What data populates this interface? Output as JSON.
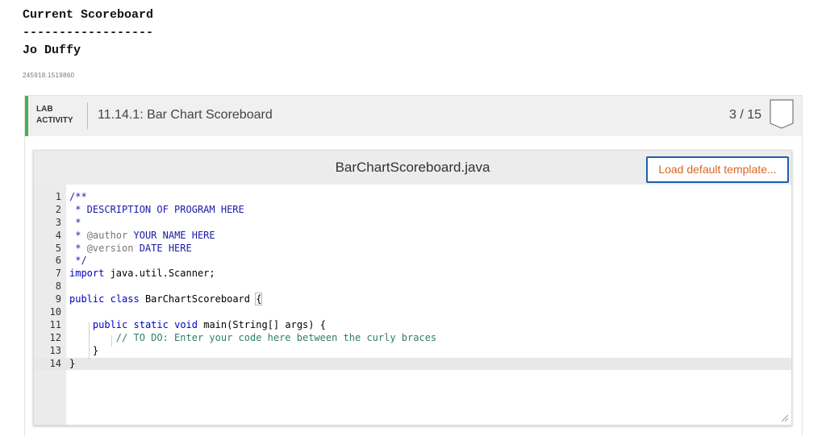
{
  "header": {
    "line1": "Current Scoreboard",
    "line2": "------------------",
    "line3": "Jo Duffy",
    "id_text": "245918.1519860"
  },
  "lab": {
    "type_line1": "LAB",
    "type_line2": "ACTIVITY",
    "title": "11.14.1: Bar Chart Scoreboard",
    "score": "3 / 15",
    "accent": "#4caf50"
  },
  "editor": {
    "filename": "BarChartScoreboard.java",
    "load_button": "Load default template...",
    "active_line": 14,
    "lines": [
      {
        "n": "1",
        "text": "/**"
      },
      {
        "n": "2",
        "text": " * DESCRIPTION OF PROGRAM HERE"
      },
      {
        "n": "3",
        "text": " *"
      },
      {
        "n": "4",
        "text": " * @author YOUR NAME HERE"
      },
      {
        "n": "5",
        "text": " * @version DATE HERE"
      },
      {
        "n": "6",
        "text": " */"
      },
      {
        "n": "7",
        "text": "import java.util.Scanner;"
      },
      {
        "n": "8",
        "text": ""
      },
      {
        "n": "9",
        "text": "public class BarChartScoreboard {"
      },
      {
        "n": "10",
        "text": ""
      },
      {
        "n": "11",
        "text": "    public static void main(String[] args) {"
      },
      {
        "n": "12",
        "text": "        // TO DO: Enter your code here between the curly braces"
      },
      {
        "n": "13",
        "text": "    }"
      },
      {
        "n": "14",
        "text": "}"
      }
    ]
  }
}
